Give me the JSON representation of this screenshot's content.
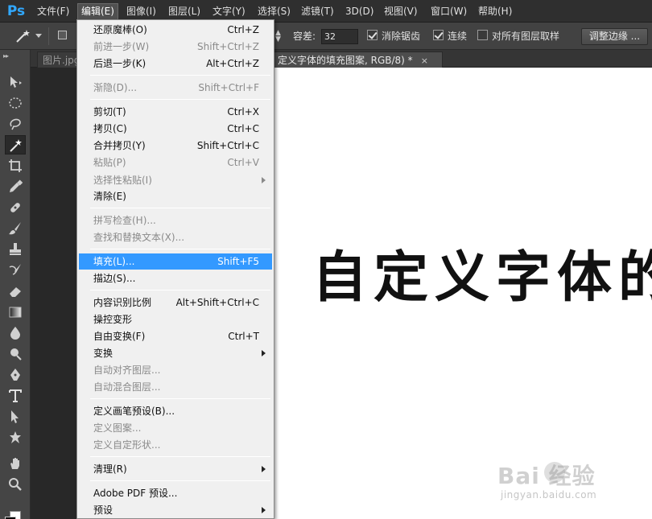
{
  "app": {
    "logo": "Ps"
  },
  "menubar": {
    "items": [
      {
        "label": "文件(F)"
      },
      {
        "label": "编辑(E)",
        "active": true
      },
      {
        "label": "图像(I)"
      },
      {
        "label": "图层(L)"
      },
      {
        "label": "文字(Y)"
      },
      {
        "label": "选择(S)"
      },
      {
        "label": "滤镜(T)"
      },
      {
        "label": "3D(D)"
      },
      {
        "label": "视图(V)"
      },
      {
        "label": "窗口(W)"
      },
      {
        "label": "帮助(H)"
      }
    ]
  },
  "options": {
    "tolerance_label": "容差:",
    "tolerance_value": "32",
    "antialias_label": "消除锯齿",
    "antialias_checked": true,
    "contiguous_label": "连续",
    "contiguous_checked": true,
    "sample_all_label": "对所有图层取样",
    "sample_all_checked": false,
    "refine_edge_button": "调整边缘 ..."
  },
  "tabs": [
    {
      "label": "图片.jpg"
    },
    {
      "label": "定义字体的填充图案, RGB/8) *",
      "active": true,
      "close": "×"
    }
  ],
  "edit_menu": {
    "items": [
      {
        "label": "还原魔棒(O)",
        "shortcut": "Ctrl+Z"
      },
      {
        "label": "前进一步(W)",
        "shortcut": "Shift+Ctrl+Z",
        "disabled": true
      },
      {
        "label": "后退一步(K)",
        "shortcut": "Alt+Ctrl+Z"
      },
      {
        "label": "渐隐(D)...",
        "shortcut": "Shift+Ctrl+F",
        "disabled": true
      },
      {
        "label": "剪切(T)",
        "shortcut": "Ctrl+X"
      },
      {
        "label": "拷贝(C)",
        "shortcut": "Ctrl+C"
      },
      {
        "label": "合并拷贝(Y)",
        "shortcut": "Shift+Ctrl+C"
      },
      {
        "label": "粘贴(P)",
        "shortcut": "Ctrl+V",
        "disabled": true
      },
      {
        "label": "选择性粘贴(I)",
        "shortcut": "",
        "disabled": true,
        "submenu": true
      },
      {
        "label": "清除(E)",
        "shortcut": ""
      },
      {
        "label": "拼写检查(H)...",
        "shortcut": "",
        "disabled": true
      },
      {
        "label": "查找和替换文本(X)...",
        "shortcut": "",
        "disabled": true
      },
      {
        "label": "填充(L)...",
        "shortcut": "Shift+F5",
        "highlighted": true
      },
      {
        "label": "描边(S)...",
        "shortcut": ""
      },
      {
        "label": "内容识别比例",
        "shortcut": "Alt+Shift+Ctrl+C"
      },
      {
        "label": "操控变形",
        "shortcut": ""
      },
      {
        "label": "自由变换(F)",
        "shortcut": "Ctrl+T"
      },
      {
        "label": "变换",
        "shortcut": "",
        "submenu": true
      },
      {
        "label": "自动对齐图层...",
        "shortcut": "",
        "disabled": true
      },
      {
        "label": "自动混合图层...",
        "shortcut": "",
        "disabled": true
      },
      {
        "label": "定义画笔预设(B)...",
        "shortcut": ""
      },
      {
        "label": "定义图案...",
        "shortcut": "",
        "disabled": true
      },
      {
        "label": "定义自定形状...",
        "shortcut": "",
        "disabled": true
      },
      {
        "label": "清理(R)",
        "shortcut": "",
        "submenu": true
      },
      {
        "label": "Adobe PDF 预设...",
        "shortcut": ""
      },
      {
        "label": "预设",
        "shortcut": "",
        "submenu": true
      }
    ]
  },
  "canvas": {
    "text": "自定义字体的"
  },
  "watermark": {
    "logo": "Bai  经验",
    "url": "jingyan.baidu.com"
  },
  "tools": [
    "move-tool-icon",
    "marquee-tool-icon",
    "lasso-tool-icon",
    "magic-wand-tool-icon",
    "crop-tool-icon",
    "eyedropper-tool-icon",
    "healing-brush-tool-icon",
    "brush-tool-icon",
    "clone-stamp-tool-icon",
    "history-brush-tool-icon",
    "eraser-tool-icon",
    "gradient-tool-icon",
    "blur-tool-icon",
    "dodge-tool-icon",
    "pen-tool-icon",
    "type-tool-icon",
    "path-selection-tool-icon",
    "shape-tool-icon",
    "hand-tool-icon",
    "zoom-tool-icon"
  ],
  "colors": {
    "menu_highlight": "#3399ff",
    "ps_blue": "#31a8ff"
  }
}
